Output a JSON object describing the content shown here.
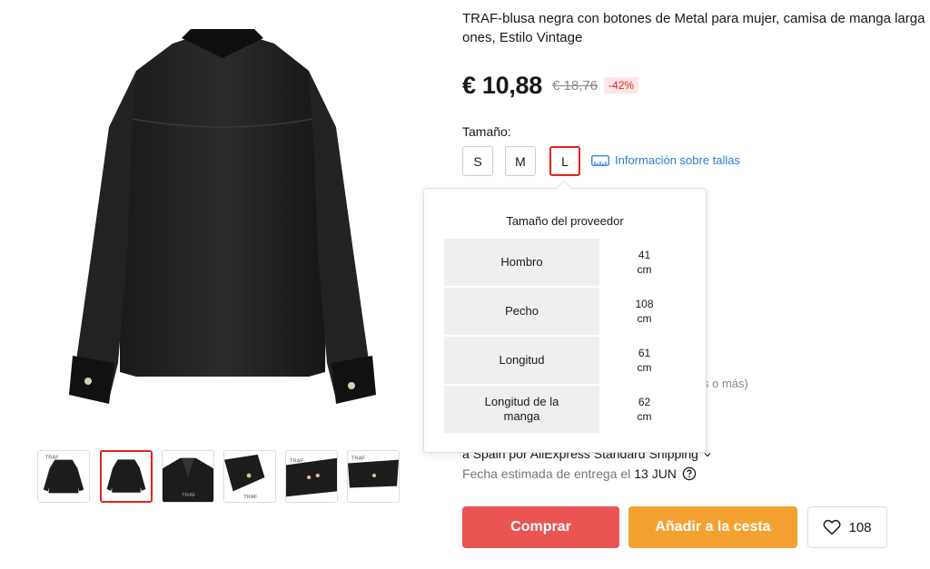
{
  "product": {
    "title": "TRAF-blusa negra con botones de Metal para mujer, camisa de manga larga",
    "title_line2": "ones, Estilo Vintage",
    "price_now": "€ 10,88",
    "price_old": "€ 18,76",
    "discount": "-42%"
  },
  "gallery": {
    "main_icon": "black-blouse-back-view",
    "thumbs": [
      {
        "icon": "blouse-front-thumb",
        "active": false
      },
      {
        "icon": "blouse-back-thumb",
        "active": true
      },
      {
        "icon": "blouse-collar-detail-thumb",
        "active": false
      },
      {
        "icon": "blouse-cuff-detail-thumb",
        "active": false
      },
      {
        "icon": "blouse-buttons-detail-thumb",
        "active": false
      },
      {
        "icon": "blouse-hem-detail-thumb",
        "active": false
      }
    ],
    "brand_tag": "TRAF"
  },
  "size": {
    "label": "Tamaño:",
    "options": [
      "S",
      "M",
      "L"
    ],
    "selected": "L",
    "info_link": "Información sobre tallas"
  },
  "popover": {
    "title": "Tamaño del proveedor",
    "rows": [
      {
        "label": "Hombro",
        "value": "41",
        "unit": "cm"
      },
      {
        "label": "Pecho",
        "value": "108",
        "unit": "cm"
      },
      {
        "label": "Longitud",
        "value": "61",
        "unit": "cm"
      },
      {
        "label": "Longitud de la manga",
        "value": "62",
        "unit": "cm"
      }
    ]
  },
  "partial": {
    "note": "s o más)"
  },
  "shipping": {
    "line": "a Spain por AliExpress Standard Shipping",
    "delivery_label": "Fecha estimada de entrega el",
    "delivery_date": "13 JUN"
  },
  "actions": {
    "buy": "Comprar",
    "cart": "Añadir a la cesta",
    "wishlist_count": "108"
  },
  "colors": {
    "accent_red": "#e2231a",
    "buy": "#ea5453",
    "cart": "#f3a232",
    "link": "#2a7fd4"
  }
}
